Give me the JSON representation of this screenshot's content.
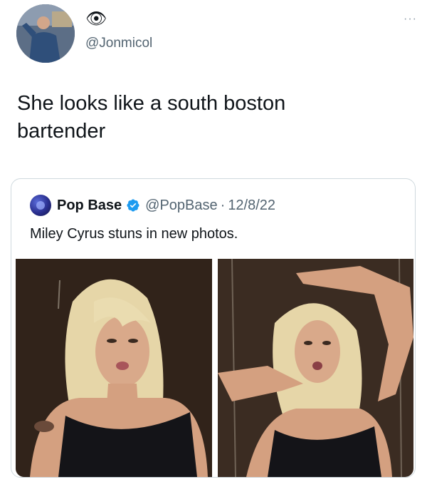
{
  "author": {
    "display_name_emoji": "👁",
    "handle": "@Jonmicol",
    "avatar_icon": "profile-photo"
  },
  "more_icon": "···",
  "tweet": {
    "text_line1": "She looks like a south boston",
    "text_line2": "bartender"
  },
  "quoted_tweet": {
    "name": "Pop Base",
    "verified_icon": "verified-badge-icon",
    "handle": "@PopBase",
    "separator": "·",
    "date": "12/8/22",
    "text": "Miley Cyrus stuns in new photos.",
    "media": [
      {
        "description_icon": "photo-left"
      },
      {
        "description_icon": "photo-right"
      }
    ]
  },
  "colors": {
    "text": "#0f1419",
    "secondary": "#536471",
    "verified": "#1d9bf0",
    "border": "#cfd9de"
  }
}
